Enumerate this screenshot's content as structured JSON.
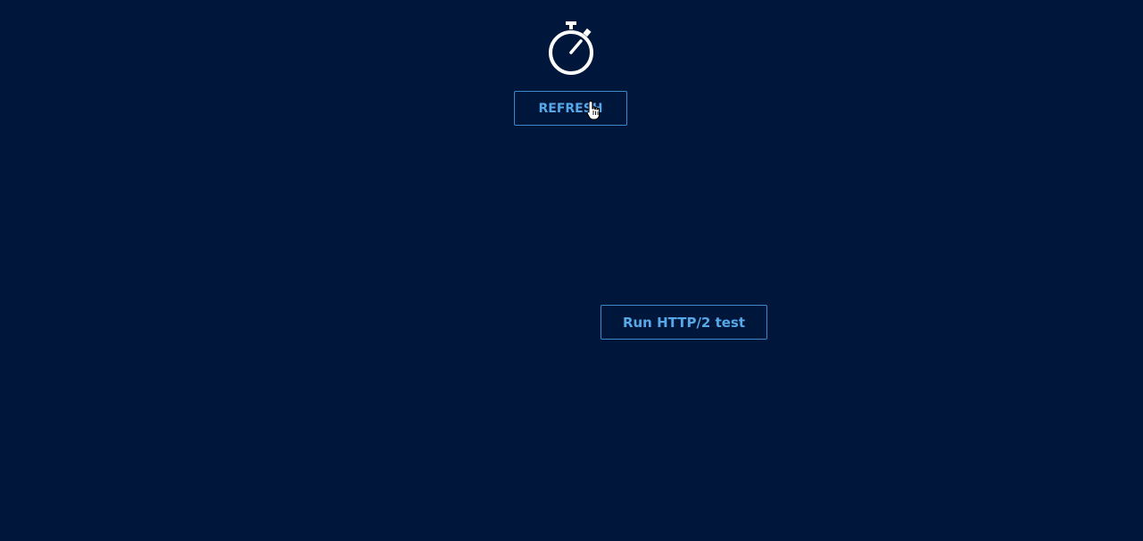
{
  "header": {
    "icon": "stopwatch-icon"
  },
  "toolbar": {
    "refresh_label": "REFRESH"
  },
  "main": {
    "http2_test_label": "Run HTTP/2 test"
  },
  "cursor": {
    "icon": "hand-pointer-icon"
  },
  "colors": {
    "background": "#00173b",
    "accent": "#57a8e9",
    "border": "#3f86c8",
    "icon": "#ffffff"
  }
}
